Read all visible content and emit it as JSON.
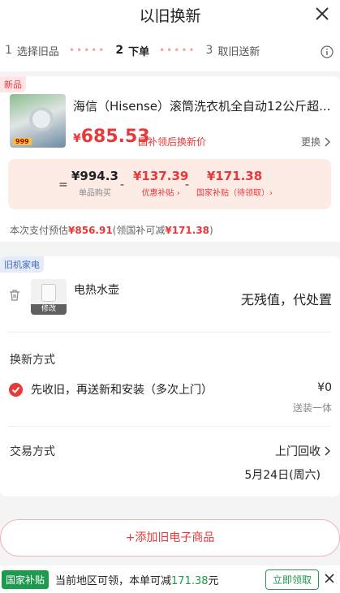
{
  "header": {
    "title": "以旧换新"
  },
  "steps": [
    {
      "num": "1",
      "label": "选择旧品"
    },
    {
      "num": "2",
      "label": "下单"
    },
    {
      "num": "3",
      "label": "取旧送新"
    }
  ],
  "new_item": {
    "badge": "新品",
    "name": "海信（Hisense）滚筒洗衣机全自动12公斤超...",
    "thumb_tag": "999",
    "price_yen": "¥",
    "price": "685.53",
    "price_label": "国补领后换新价",
    "swap_label": "更换",
    "breakdown": {
      "eq": "=",
      "unit": {
        "value": "¥994.3",
        "label": "单品购买"
      },
      "op1": "-",
      "coupon": {
        "value": "¥137.39",
        "label": "优惠补贴 ›"
      },
      "op2": "-",
      "subsidy": {
        "value": "¥171.38",
        "label": "国家补贴（待领取）›"
      }
    },
    "pay_prefix": "本次支付预估",
    "pay_amount": "¥856.91",
    "pay_mid": "(领国补可减",
    "pay_reduce": "¥171.38",
    "pay_suffix": ")"
  },
  "old_item": {
    "badge": "旧机家电",
    "name": "电热水壶",
    "edit_label": "修改",
    "value_text": "无残值，代处置"
  },
  "swap_method": {
    "title": "换新方式",
    "option": "先收旧，再送新和安装（多次上门）",
    "fee": "¥0",
    "fee_note": "送装一体"
  },
  "trade_method": {
    "title": "交易方式",
    "value": "上门回收",
    "date": "5月24日(周六)"
  },
  "add_button": "+添加旧电子商品",
  "bottom_bar": {
    "badge": "国家补贴",
    "text_prefix": "当前地区可领，本单可减",
    "amount": "171.38",
    "text_suffix": "元",
    "claim": "立即领取"
  },
  "colors": {
    "accent": "#e83838",
    "gov_green": "#1e9a4e",
    "price_box": "#fdebe6"
  }
}
